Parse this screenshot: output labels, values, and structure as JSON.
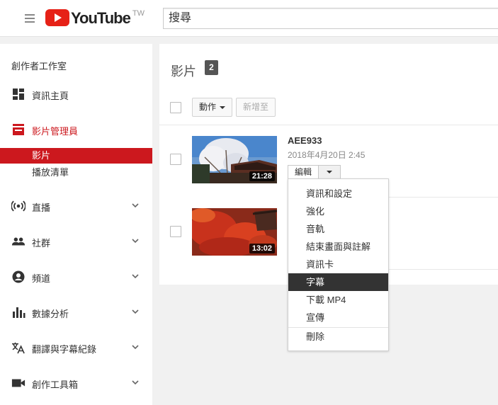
{
  "header": {
    "logo_text": "YouTube",
    "region": "TW",
    "search_placeholder": "搜尋"
  },
  "sidebar": {
    "studio_title": "創作者工作室",
    "items": [
      {
        "label": "資訊主頁",
        "icon": "dashboard-icon"
      },
      {
        "label": "影片管理員",
        "icon": "video-manager-icon",
        "active": true
      },
      {
        "label": "直播",
        "icon": "live-icon"
      },
      {
        "label": "社群",
        "icon": "community-icon"
      },
      {
        "label": "頻道",
        "icon": "channel-icon"
      },
      {
        "label": "數據分析",
        "icon": "analytics-icon"
      },
      {
        "label": "翻譯與字幕紀錄",
        "icon": "translate-icon"
      },
      {
        "label": "創作工具箱",
        "icon": "create-icon"
      }
    ],
    "subitems": [
      {
        "label": "影片",
        "selected": true
      },
      {
        "label": "播放清單"
      }
    ]
  },
  "main": {
    "title": "影片",
    "count": "2",
    "actions_button": "動作",
    "add_to_button": "新增至",
    "videos": [
      {
        "title": "AEE933",
        "date": "2018年4月20日 2:45",
        "duration": "21:28",
        "edit_label": "編輯"
      },
      {
        "title": "",
        "date": "",
        "duration": "13:02"
      }
    ]
  },
  "edit_menu": {
    "items": [
      {
        "label": "資訊和設定"
      },
      {
        "label": "強化"
      },
      {
        "label": "音軌"
      },
      {
        "label": "結束畫面與註解"
      },
      {
        "label": "資訊卡"
      },
      {
        "label": "字幕",
        "selected": true
      },
      {
        "label": "下載 MP4"
      },
      {
        "label": "宣傳"
      },
      {
        "label": "刪除"
      }
    ]
  },
  "colors": {
    "accent": "#cc181e",
    "logo_red": "#e62117",
    "menu_selected": "#333333"
  }
}
